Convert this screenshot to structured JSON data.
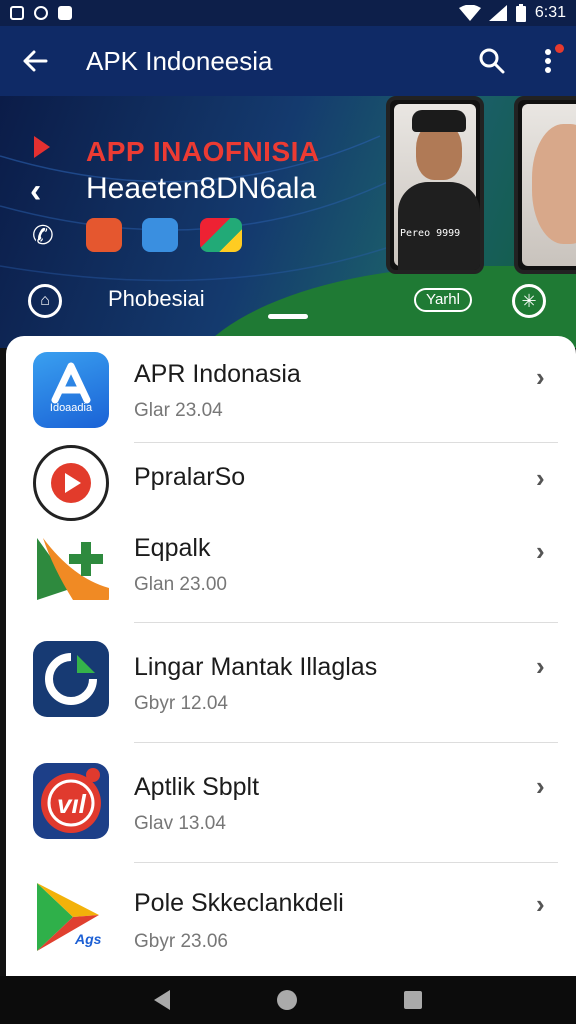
{
  "status_bar": {
    "time": "6:31",
    "icons": [
      "notification-icon",
      "message-icon",
      "square-icon",
      "wifi-icon",
      "signal-icon",
      "battery-icon"
    ]
  },
  "app_bar": {
    "title": "APK Indoneesia",
    "icons": [
      "arrow-back-icon",
      "search-icon",
      "more-vert-icon"
    ]
  },
  "banner": {
    "title": "APP INAOFNISIA",
    "subtitle": "Heaeten8DN6ala",
    "label": "Phobesiai",
    "pill": "Yarhl",
    "phone_text": "Pereo 9999"
  },
  "items": [
    {
      "name": "APR Indonasia",
      "sub": "Glar 23.04",
      "icon_text": "Idoaadia",
      "icon": "app-store-icon"
    },
    {
      "name": "PpralarSo",
      "sub": "",
      "icon_text": "",
      "icon": "youtube-play-icon"
    },
    {
      "name": "Eqpalk",
      "sub": "Glan 23.00",
      "icon_text": "",
      "icon": "plus-app-icon"
    },
    {
      "name": "Lingar Mantak Illaglas",
      "sub": "Gbyr 12.04",
      "icon_text": "",
      "icon": "refresh-app-icon"
    },
    {
      "name": "Aptlik Sbplt",
      "sub": "Glav 13.04",
      "icon_text": "",
      "icon": "red-app-icon"
    },
    {
      "name": "Pole Skkeclankdeli",
      "sub": "Gbyr 23.06",
      "icon_text": "Ags",
      "icon": "play-store-icon"
    }
  ],
  "colors": {
    "app_bar": "#0f2a66",
    "accent_red": "#ec3b33",
    "banner_green": "#1f7a34"
  }
}
